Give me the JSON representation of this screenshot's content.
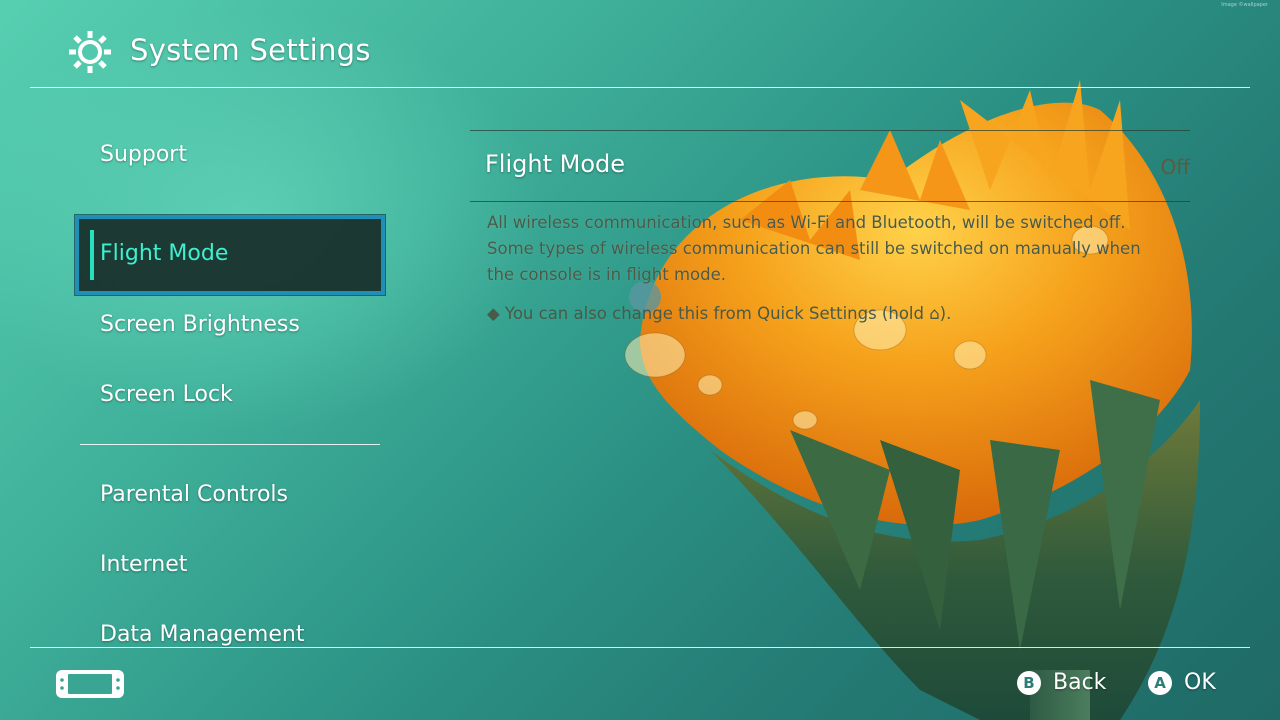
{
  "header": {
    "title": "System Settings",
    "icon": "gear-icon"
  },
  "sidebar": {
    "items": [
      {
        "label": "Support"
      },
      {
        "label": "Flight Mode",
        "selected": true
      },
      {
        "label": "Screen Brightness"
      },
      {
        "label": "Screen Lock"
      },
      {
        "label": "Parental Controls"
      },
      {
        "label": "Internet"
      },
      {
        "label": "Data Management"
      }
    ]
  },
  "detail": {
    "title": "Flight Mode",
    "value": "Off",
    "description_lines": [
      "All wireless communication, such as Wi-Fi and Bluetooth, will be switched off.",
      "Some types of wireless communication can still be switched on manually when",
      "the console is in flight mode."
    ],
    "hint": "◆ You can also change this from Quick Settings (hold ⌂)."
  },
  "footer": {
    "back_key": "B",
    "back_label": "Back",
    "ok_key": "A",
    "ok_label": "OK"
  },
  "watermark": "Image ©wallpaper",
  "colors": {
    "accent_selected_text": "#3ef0cf",
    "selection_border": "#1f8fb8",
    "flower_orange": "#f39a1a"
  }
}
